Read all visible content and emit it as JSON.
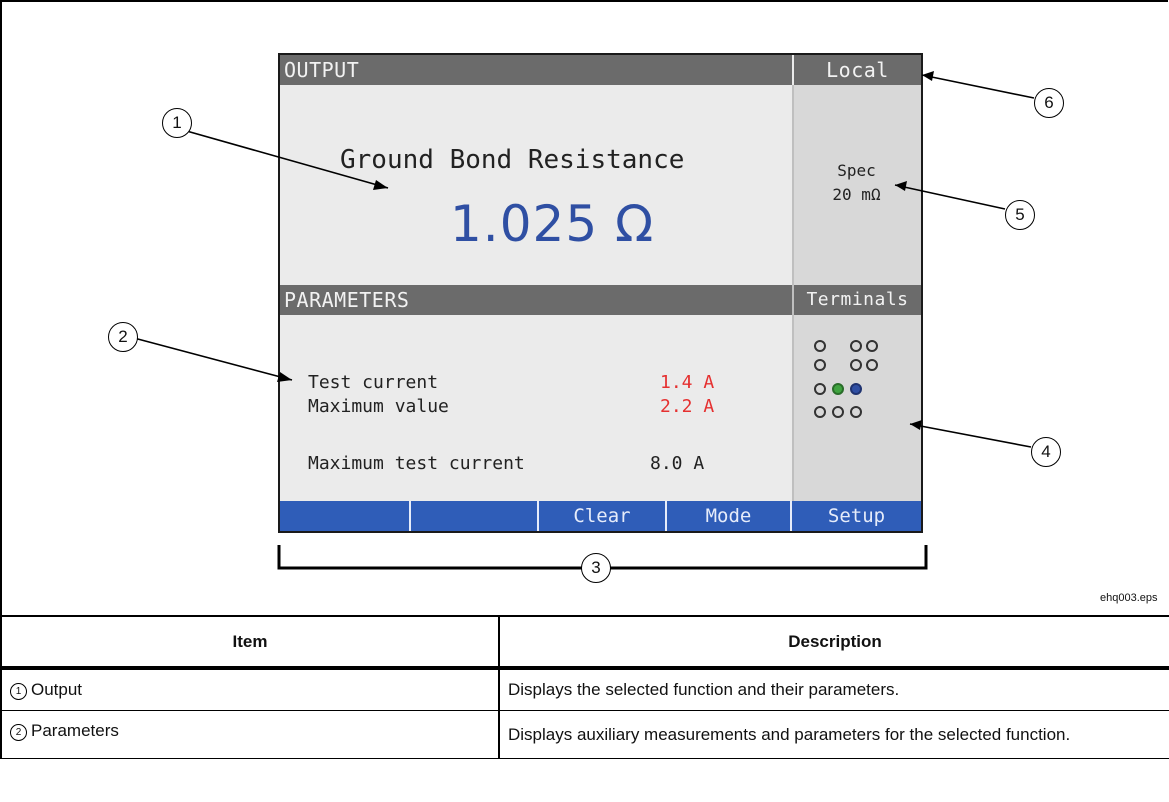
{
  "screen": {
    "output_header": "OUTPUT",
    "mode_label": "Local",
    "function_name": "Ground Bond Resistance",
    "reading": "1.025 Ω",
    "spec_label": "Spec",
    "spec_value": "20 mΩ",
    "parameters_header": "PARAMETERS",
    "terminals_header": "Terminals",
    "params": [
      {
        "label": "Test current",
        "value": "1.4 A"
      },
      {
        "label": "Maximum value",
        "value": "2.2 A"
      },
      {
        "label": "Maximum test current",
        "value": "8.0 A"
      }
    ],
    "softkeys": [
      "",
      "",
      "Clear",
      "Mode",
      "Setup"
    ],
    "colors": {
      "reading": "#2f4fa3",
      "header_bar": "#6b6b6b",
      "softkey_bar": "#2f5db8",
      "param_highlight": "#e53030",
      "terminal_green": "#3fa33f",
      "terminal_blue": "#2f4fa3"
    }
  },
  "callouts": [
    "1",
    "2",
    "3",
    "4",
    "5",
    "6"
  ],
  "figure_file": "ehq003.eps",
  "table": {
    "headers": [
      "Item",
      "Description"
    ],
    "rows": [
      {
        "num": "1",
        "item": "Output",
        "desc": "Displays the selected function and their parameters."
      },
      {
        "num": "2",
        "item": "Parameters",
        "desc": "Displays auxiliary measurements and parameters for the selected function."
      }
    ]
  }
}
